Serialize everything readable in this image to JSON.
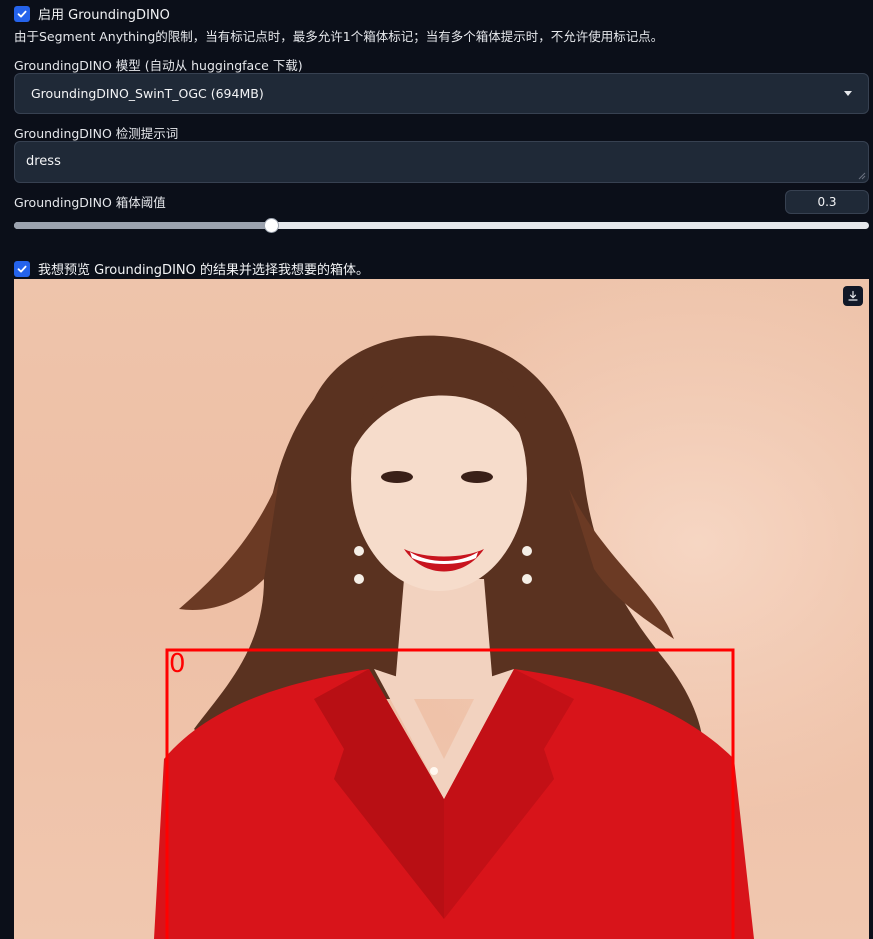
{
  "grounding_enable": {
    "label": "启用 GroundingDINO",
    "checked": true
  },
  "limit_note": "由于Segment Anything的限制，当有标记点时，最多允许1个箱体标记；当有多个箱体提示时，不允许使用标记点。",
  "model_select": {
    "label": "GroundingDINO 模型 (自动从 huggingface 下载)",
    "value": "GroundingDINO_SwinT_OGC (694MB)"
  },
  "prompt_field": {
    "label": "GroundingDINO 检测提示词",
    "value": "dress"
  },
  "box_threshold": {
    "label": "GroundingDINO 箱体阈值",
    "value": "0.3",
    "fraction": 0.3
  },
  "preview_toggle": {
    "label": "我想预览 GroundingDINO 的结果并选择我想要的箱体。",
    "checked": true
  },
  "preview_image": {
    "box_index_label": "0",
    "box_color": "#ff0000"
  },
  "colors": {
    "accent": "#2563eb",
    "background": "#0b0f19",
    "input": "#1f2937"
  },
  "icons": {
    "checkbox": "check-icon",
    "dropdown": "chevron-down-icon",
    "download": "download-icon"
  }
}
